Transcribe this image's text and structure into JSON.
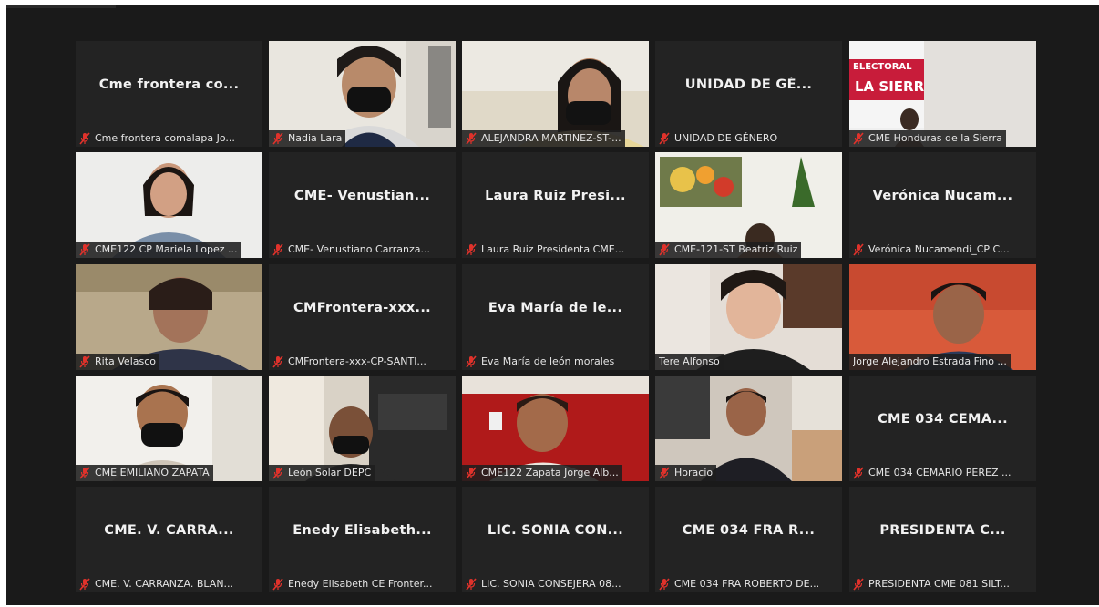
{
  "colors": {
    "background": "#1a1a1a",
    "tile": "#232323",
    "active_speaker": "#b4e356",
    "muted_icon": "#e0322b"
  },
  "icons": {
    "muted": "mic-muted-icon"
  },
  "participants": [
    {
      "title": "Cme frontera co...",
      "label": "Cme frontera comalapa Jo...",
      "video": false,
      "muted": true
    },
    {
      "title": "",
      "label": "Nadia Lara",
      "video": true,
      "muted": true
    },
    {
      "title": "",
      "label": "ALEJANDRA MARTINEZ-ST-...",
      "video": true,
      "muted": true
    },
    {
      "title": "UNIDAD DE GÉ...",
      "label": "UNIDAD DE GÉNERO",
      "video": false,
      "muted": true
    },
    {
      "title": "",
      "label": "CME Honduras de la Sierra",
      "video": true,
      "muted": true,
      "banner_text": [
        "ELECTORAL",
        "LA SIERRA"
      ]
    },
    {
      "title": "",
      "label": "CME122 CP Mariela Lopez ...",
      "video": true,
      "muted": true
    },
    {
      "title": "CME- Venustian...",
      "label": "CME- Venustiano Carranza...",
      "video": false,
      "muted": true
    },
    {
      "title": "Laura Ruiz Presi...",
      "label": "Laura Ruiz Presidenta CME...",
      "video": false,
      "muted": true
    },
    {
      "title": "",
      "label": "CME-121-ST Beatriz Ruiz",
      "video": true,
      "muted": true
    },
    {
      "title": "Verónica Nucam...",
      "label": "Verónica Nucamendi_CP C...",
      "video": false,
      "muted": true
    },
    {
      "title": "",
      "label": "Rita Velasco",
      "video": true,
      "muted": true
    },
    {
      "title": "CMFrontera-xxx...",
      "label": "CMFrontera-xxx-CP-SANTI...",
      "video": false,
      "muted": true
    },
    {
      "title": "Eva María de le...",
      "label": "Eva María de león morales",
      "video": false,
      "muted": true
    },
    {
      "title": "",
      "label": "Tere Alfonso",
      "video": true,
      "muted": false,
      "active": true
    },
    {
      "title": "",
      "label": "Jorge Alejandro Estrada Fino ...",
      "video": true,
      "muted": false
    },
    {
      "title": "",
      "label": "CME EMILIANO ZAPATA",
      "video": true,
      "muted": true
    },
    {
      "title": "",
      "label": "León Solar DEPC",
      "video": true,
      "muted": true
    },
    {
      "title": "",
      "label": "CME122 Zapata Jorge Alb...",
      "video": true,
      "muted": true
    },
    {
      "title": "",
      "label": "Horacio",
      "video": true,
      "muted": true
    },
    {
      "title": "CME 034 CEMA...",
      "label": "CME 034 CEMARIO PEREZ ...",
      "video": false,
      "muted": true
    },
    {
      "title": "CME. V. CARRA...",
      "label": "CME. V. CARRANZA. BLAN...",
      "video": false,
      "muted": true
    },
    {
      "title": "Enedy Elisabeth...",
      "label": "Enedy Elisabeth CE Fronter...",
      "video": false,
      "muted": true
    },
    {
      "title": "LIC. SONIA CON...",
      "label": "LIC. SONIA CONSEJERA 08...",
      "video": false,
      "muted": true
    },
    {
      "title": "CME 034 FRA R...",
      "label": "CME 034 FRA ROBERTO DE...",
      "video": false,
      "muted": true
    },
    {
      "title": "PRESIDENTA C...",
      "label": "PRESIDENTA CME 081 SILT...",
      "video": false,
      "muted": true
    }
  ]
}
